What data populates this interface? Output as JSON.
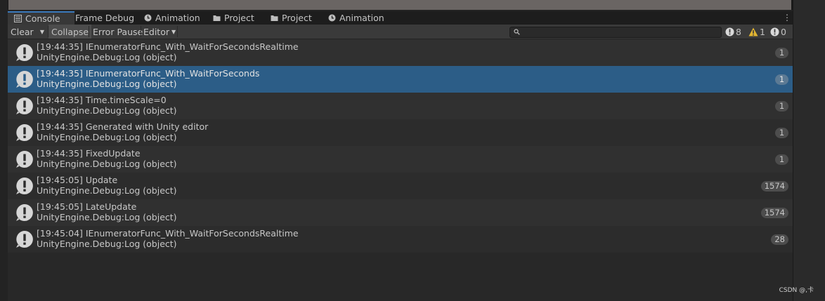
{
  "tabs": [
    {
      "label": "Console",
      "icon": "console-icon",
      "active": true
    },
    {
      "label": "Frame Debug",
      "icon": "",
      "active": false
    },
    {
      "label": "Animation",
      "icon": "animation-icon",
      "active": false
    },
    {
      "label": "Project",
      "icon": "folder-icon",
      "active": false
    },
    {
      "label": "Project",
      "icon": "folder-icon",
      "active": false
    },
    {
      "label": "Animation",
      "icon": "animation-icon",
      "active": false
    }
  ],
  "toolbar": {
    "clear_label": "Clear",
    "collapse_label": "Collapse",
    "error_pause_label": "Error Pause",
    "editor_label": "Editor",
    "search_placeholder": "",
    "info_count": "8",
    "warning_count": "1",
    "error_count": "0"
  },
  "logs": [
    {
      "message": "[19:44:35] IEnumeratorFunc_With_WaitForSecondsRealtime",
      "stack": "UnityEngine.Debug:Log (object)",
      "count": "1",
      "selected": false
    },
    {
      "message": "[19:44:35] IEnumeratorFunc_With_WaitForSeconds",
      "stack": "UnityEngine.Debug:Log (object)",
      "count": "1",
      "selected": true
    },
    {
      "message": "[19:44:35] Time.timeScale=0",
      "stack": "UnityEngine.Debug:Log (object)",
      "count": "1",
      "selected": false
    },
    {
      "message": "[19:44:35] Generated with Unity editor",
      "stack": "UnityEngine.Debug:Log (object)",
      "count": "1",
      "selected": false
    },
    {
      "message": "[19:44:35] FixedUpdate",
      "stack": "UnityEngine.Debug:Log (object)",
      "count": "1",
      "selected": false
    },
    {
      "message": "[19:45:05] Update",
      "stack": "UnityEngine.Debug:Log (object)",
      "count": "1574",
      "selected": false
    },
    {
      "message": "[19:45:05] LateUpdate",
      "stack": "UnityEngine.Debug:Log (object)",
      "count": "1574",
      "selected": false
    },
    {
      "message": "[19:45:04] IEnumeratorFunc_With_WaitForSecondsRealtime",
      "stack": "UnityEngine.Debug:Log (object)",
      "count": "28",
      "selected": false
    }
  ],
  "watermark": "CSDN @,卡",
  "colors": {
    "accent": "#3a79bb",
    "selected_row": "#2c5d87",
    "warning": "#e2b531"
  }
}
